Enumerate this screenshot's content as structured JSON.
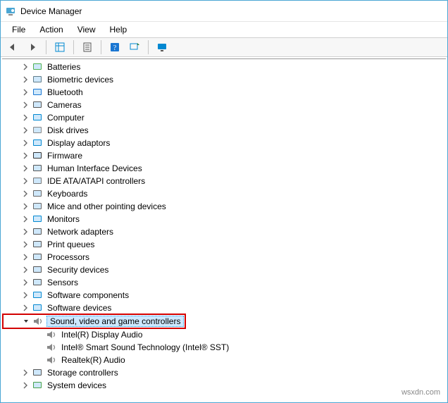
{
  "window": {
    "title": "Device Manager"
  },
  "menubar": {
    "file": "File",
    "action": "Action",
    "view": "View",
    "help": "Help"
  },
  "tree": {
    "items": [
      {
        "label": "Batteries",
        "iconColor": "#4caf50"
      },
      {
        "label": "Biometric devices",
        "iconColor": "#607d8b"
      },
      {
        "label": "Bluetooth",
        "iconColor": "#1976d2"
      },
      {
        "label": "Cameras",
        "iconColor": "#555"
      },
      {
        "label": "Computer",
        "iconColor": "#0288d1"
      },
      {
        "label": "Disk drives",
        "iconColor": "#888"
      },
      {
        "label": "Display adaptors",
        "iconColor": "#0288d1"
      },
      {
        "label": "Firmware",
        "iconColor": "#333"
      },
      {
        "label": "Human Interface Devices",
        "iconColor": "#555"
      },
      {
        "label": "IDE ATA/ATAPI controllers",
        "iconColor": "#777"
      },
      {
        "label": "Keyboards",
        "iconColor": "#666"
      },
      {
        "label": "Mice and other pointing devices",
        "iconColor": "#666"
      },
      {
        "label": "Monitors",
        "iconColor": "#0288d1"
      },
      {
        "label": "Network adapters",
        "iconColor": "#555"
      },
      {
        "label": "Print queues",
        "iconColor": "#555"
      },
      {
        "label": "Processors",
        "iconColor": "#555"
      },
      {
        "label": "Security devices",
        "iconColor": "#555"
      },
      {
        "label": "Sensors",
        "iconColor": "#555"
      },
      {
        "label": "Software components",
        "iconColor": "#0288d1"
      },
      {
        "label": "Software devices",
        "iconColor": "#0288d1"
      }
    ],
    "expanded": {
      "label": "Sound, video and game controllers",
      "children": [
        {
          "label": "Intel(R) Display Audio"
        },
        {
          "label": "Intel® Smart Sound Technology (Intel® SST)"
        },
        {
          "label": "Realtek(R) Audio"
        }
      ]
    },
    "after": [
      {
        "label": "Storage controllers",
        "iconColor": "#555"
      },
      {
        "label": "System devices",
        "iconColor": "#46a049"
      }
    ]
  },
  "watermark": "wsxdn.com"
}
